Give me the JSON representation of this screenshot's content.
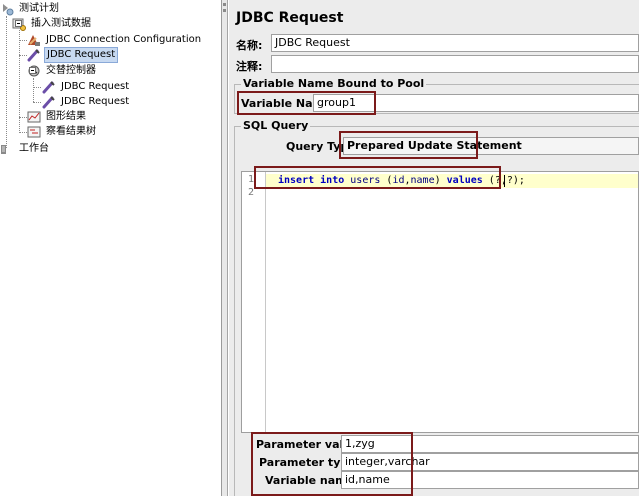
{
  "tree": {
    "items": [
      {
        "label": "测试计划",
        "icon": "test-plan-icon",
        "selected": false
      },
      {
        "label": "插入测试数据",
        "icon": "thread-group-icon",
        "selected": false
      },
      {
        "label": "JDBC Connection Configuration",
        "icon": "config-element-icon",
        "selected": false
      },
      {
        "label": "JDBC Request",
        "icon": "jdbc-sampler-icon",
        "selected": true
      },
      {
        "label": "交替控制器",
        "icon": "controller-icon",
        "selected": false
      },
      {
        "label": "JDBC Request",
        "icon": "jdbc-sampler-icon",
        "selected": false
      },
      {
        "label": "JDBC Request",
        "icon": "jdbc-sampler-icon",
        "selected": false
      },
      {
        "label": "图形结果",
        "icon": "graph-listener-icon",
        "selected": false
      },
      {
        "label": "察看结果树",
        "icon": "results-tree-icon",
        "selected": false
      },
      {
        "label": "工作台",
        "icon": "workbench-icon",
        "selected": false
      }
    ]
  },
  "panel": {
    "title": "JDBC Request",
    "name_label": "名称:",
    "name_value": "JDBC Request",
    "comment_label": "注释:",
    "comment_value": "",
    "pool_group_title": "Variable Name Bound to Pool",
    "variable_name_label": "Variable Name:",
    "variable_name_value": "group1",
    "sql_group_title": "SQL Query",
    "query_type_label": "Query Type:",
    "query_type_value": "Prepared Update Statement",
    "editor": {
      "line_numbers": [
        "1",
        "2"
      ],
      "tokens": [
        {
          "text": "insert",
          "kind": "kw"
        },
        {
          "text": " ",
          "kind": "pu"
        },
        {
          "text": "into",
          "kind": "kw"
        },
        {
          "text": " ",
          "kind": "pu"
        },
        {
          "text": "users",
          "kind": "id"
        },
        {
          "text": " (",
          "kind": "pu"
        },
        {
          "text": "id",
          "kind": "id"
        },
        {
          "text": ",",
          "kind": "pu"
        },
        {
          "text": "name",
          "kind": "id"
        },
        {
          "text": ") ",
          "kind": "pu"
        },
        {
          "text": "values",
          "kind": "kw"
        },
        {
          "text": " (?,?);",
          "kind": "pu"
        }
      ]
    },
    "parameter_values_label": "Parameter values:",
    "parameter_values_value": "1,zyg",
    "parameter_types_label": "Parameter types:",
    "parameter_types_value": "integer,varchar",
    "variable_names_label": "Variable names:",
    "variable_names_value": "id,name"
  },
  "colors": {
    "highlight_border": "#7b1a1a",
    "selection_bg": "#c7d9f1",
    "current_line_bg": "#ffffcc",
    "keyword": "#0000c0"
  }
}
